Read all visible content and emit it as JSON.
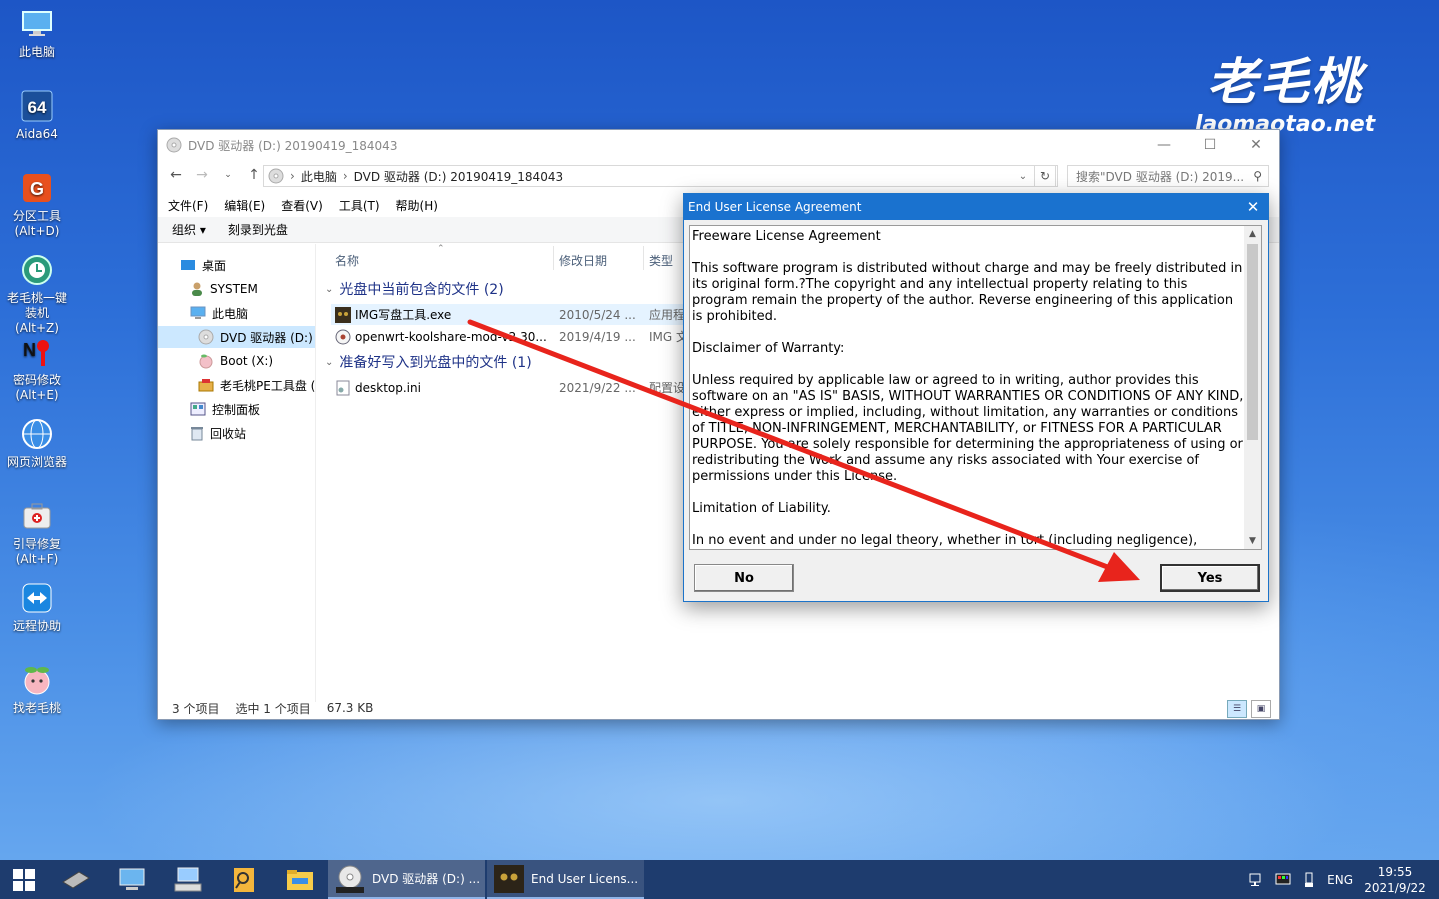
{
  "desktop": {
    "icons": [
      {
        "label": "此电脑"
      },
      {
        "label": "Aida64"
      },
      {
        "label": "分区工具\n(Alt+D)"
      },
      {
        "label": "老毛桃一键\n装机(Alt+Z)"
      },
      {
        "label": "密码修改\n(Alt+E)"
      },
      {
        "label": "网页浏览器"
      },
      {
        "label": "引导修复\n(Alt+F)"
      },
      {
        "label": "远程协助"
      },
      {
        "label": "找老毛桃"
      }
    ],
    "brand_cn": "老毛桃",
    "brand_en": "laomaotao.net"
  },
  "explorer": {
    "title": "DVD 驱动器 (D:) 20190419_184043",
    "breadcrumb": [
      "此电脑",
      "DVD 驱动器 (D:) 20190419_184043"
    ],
    "search_placeholder": "搜索\"DVD 驱动器 (D:) 2019...",
    "menu": [
      "文件(F)",
      "编辑(E)",
      "查看(V)",
      "工具(T)",
      "帮助(H)"
    ],
    "commands": [
      "组织 ▾",
      "刻录到光盘"
    ],
    "nav_tree": [
      {
        "label": "桌面"
      },
      {
        "label": "SYSTEM"
      },
      {
        "label": "此电脑"
      },
      {
        "label": "DVD 驱动器 (D:)"
      },
      {
        "label": "Boot (X:)"
      },
      {
        "label": "老毛桃PE工具盘 ("
      },
      {
        "label": "控制面板"
      },
      {
        "label": "回收站"
      }
    ],
    "columns": [
      "名称",
      "修改日期",
      "类型"
    ],
    "groups": [
      {
        "title": "光盘中当前包含的文件 (2)",
        "files": [
          {
            "name": "IMG写盘工具.exe",
            "date": "2010/5/24 ...",
            "type": "应用程"
          },
          {
            "name": "openwrt-koolshare-mod-v2.30...",
            "date": "2019/4/19 ...",
            "type": "IMG 文"
          }
        ]
      },
      {
        "title": "准备好写入到光盘中的文件 (1)",
        "files": [
          {
            "name": "desktop.ini",
            "date": "2021/9/22 ...",
            "type": "配置设"
          }
        ]
      }
    ],
    "status": {
      "count": "3 个项目",
      "selected": "选中 1 个项目",
      "size": "67.3 KB"
    }
  },
  "dialog": {
    "title": "End User License Agreement",
    "paragraphs": [
      "Freeware License Agreement",
      "This software program is distributed without charge and may be freely distributed in its original form.?The copyright and any intellectual property relating to this program remain the property of the author. Reverse engineering of this application is prohibited.",
      "Disclaimer of Warranty:",
      "Unless required by applicable law or agreed to in writing, author provides this software on an \"AS IS\" BASIS, WITHOUT WARRANTIES OR CONDITIONS OF ANY KIND, either express or implied, including, without limitation, any warranties or conditions of TITLE, NON-INFRINGEMENT, MERCHANTABILITY, or FITNESS FOR A PARTICULAR PURPOSE. You are solely responsible for determining the appropriateness of using or redistributing the Work and assume any risks associated with Your exercise of permissions under this License.",
      "Limitation of Liability.",
      "In no event and under no legal theory, whether in tort (including negligence), contract,"
    ],
    "no_label": "No",
    "yes_label": "Yes"
  },
  "taskbar": {
    "tasks": [
      {
        "label": "DVD 驱动器 (D:) ..."
      },
      {
        "label": "End User Licens..."
      }
    ],
    "lang": "ENG",
    "time": "19:55",
    "date": "2021/9/22"
  },
  "colors": {
    "dialog_title": "#1a72cf",
    "annotation_arrow": "#e8241c",
    "group_header": "#1e3287"
  }
}
